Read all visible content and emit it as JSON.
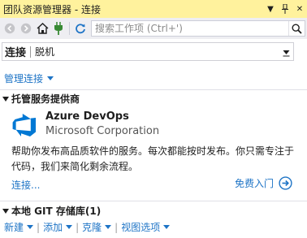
{
  "window": {
    "title": "团队资源管理器 - 连接"
  },
  "toolbar": {
    "search_placeholder": "搜索工作项 (Ctrl+')"
  },
  "nav": {
    "current": "连接",
    "secondary": "脱机"
  },
  "manage_connections": "管理连接",
  "hosted": {
    "heading": "托管服务提供商",
    "provider_name": "Azure DevOps",
    "provider_company": "Microsoft Corporation",
    "description": "帮助你发布高品质软件的服务。每次都能按时发布。你只需专注于代码，我们来简化剩余流程。",
    "connect_link": "连接...",
    "get_started": "免费入门"
  },
  "git": {
    "heading": "本地 GIT 存储库(1)",
    "actions": [
      "新建",
      "添加",
      "克隆",
      "视图选项"
    ]
  },
  "colors": {
    "title_bar": "#fff29d",
    "link": "#1e74c6",
    "azure": "#0078d4"
  }
}
